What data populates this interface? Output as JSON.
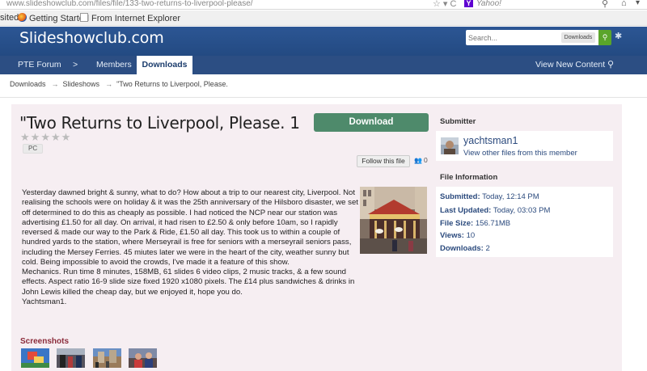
{
  "browser": {
    "url": "www.slideshowclub.com/files/file/133-two-returns-to-liverpool-please/",
    "search_engine_label": "Yahoo!",
    "bookmarks": [
      "sited",
      "Getting Started",
      "From Internet Explorer"
    ]
  },
  "site": {
    "logo": "Slideshowclub.com",
    "search_placeholder": "Search...",
    "search_scope": "Downloads"
  },
  "nav": {
    "items": [
      "PTE Forum",
      ">",
      "Members",
      "Downloads"
    ],
    "right": "View New Content",
    "active": "Downloads"
  },
  "breadcrumb": [
    "Downloads",
    "Slideshows",
    "\"Two Returns to Liverpool, Please."
  ],
  "file": {
    "title": "\"Two Returns to Liverpool, Please. 1",
    "rating_stars": 5,
    "rating_value": 0,
    "tag": "PC",
    "download_label": "Download",
    "follow_label": "Follow this file",
    "follower_count": "0",
    "description": [
      "Yesterday dawned bright & sunny, what to do? How about a trip to our nearest city, Liverpool. Not realising the schools were on holiday & it was the 25th anniversary of the Hilsboro disaster, we set off determined to do this as cheaply as possible. I had noticed the NCP near our station was advertising £1.50 for all day. On arrival, it had risen to £2.50 & only before 10am, so I rapidly reversed & made our way to the Park & Ride, £1.50 all day. This took us to within a couple of hundred yards to the station, where Merseyrail is free for seniors with a merseyrail seniors pass, including the Mersey Ferries. 45 miutes later we were in the heart of the city, weather sunny but cold. Being impossible to avoid the crowds, I've made it a feature of this show.",
      "Mechanics. Run time 8 minutes, 158MB, 61 slides 6 video clips, 2 music tracks, & a few sound effects. Aspect ratio 16-9 slide size fixed 1920 x1080 pixels. The £14 plus sandwiches & drinks in John Lewis killed the cheap day, but we enjoyed it, hope you do.",
      "Yachtsman1."
    ],
    "screenshots_label": "Screenshots"
  },
  "submitter": {
    "heading": "Submitter",
    "name": "yachtsman1",
    "link": "View other files from this member"
  },
  "file_info": {
    "heading": "File Information",
    "rows": [
      {
        "label": "Submitted:",
        "value": "Today, 12:14 PM"
      },
      {
        "label": "Last Updated:",
        "value": "Today, 03:03 PM"
      },
      {
        "label": "File Size:",
        "value": "156.71MB"
      },
      {
        "label": "Views:",
        "value": "10"
      },
      {
        "label": "Downloads:",
        "value": "2"
      }
    ]
  },
  "icons": {
    "star": "star-icon",
    "home": "home-icon",
    "search": "search-icon",
    "gear": "gear-icon",
    "pin": "map-pin-icon",
    "people": "people-icon"
  },
  "colors": {
    "header": "#2c5694",
    "nav": "#2c4e83",
    "download": "#4e8a6b",
    "search_button": "#5aa52a",
    "panel": "#f6eef2",
    "link": "#2b4a7d",
    "screenshots_heading": "#8b2b3a"
  }
}
